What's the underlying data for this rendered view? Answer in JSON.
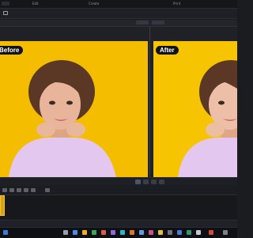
{
  "menu": {
    "items": [
      "Edit",
      "Create",
      "Print"
    ]
  },
  "preview": {
    "before_label": "Before",
    "after_label": "After"
  },
  "colors": {
    "background_yellow": "#f6c400",
    "sweater": "#e3c7ee",
    "hair": "#5a3825",
    "skin": "#e8b59a",
    "clip": "#d8a317"
  },
  "icons": [
    "folder-icon",
    "play-icon",
    "stop-icon",
    "prev-icon",
    "next-icon"
  ]
}
